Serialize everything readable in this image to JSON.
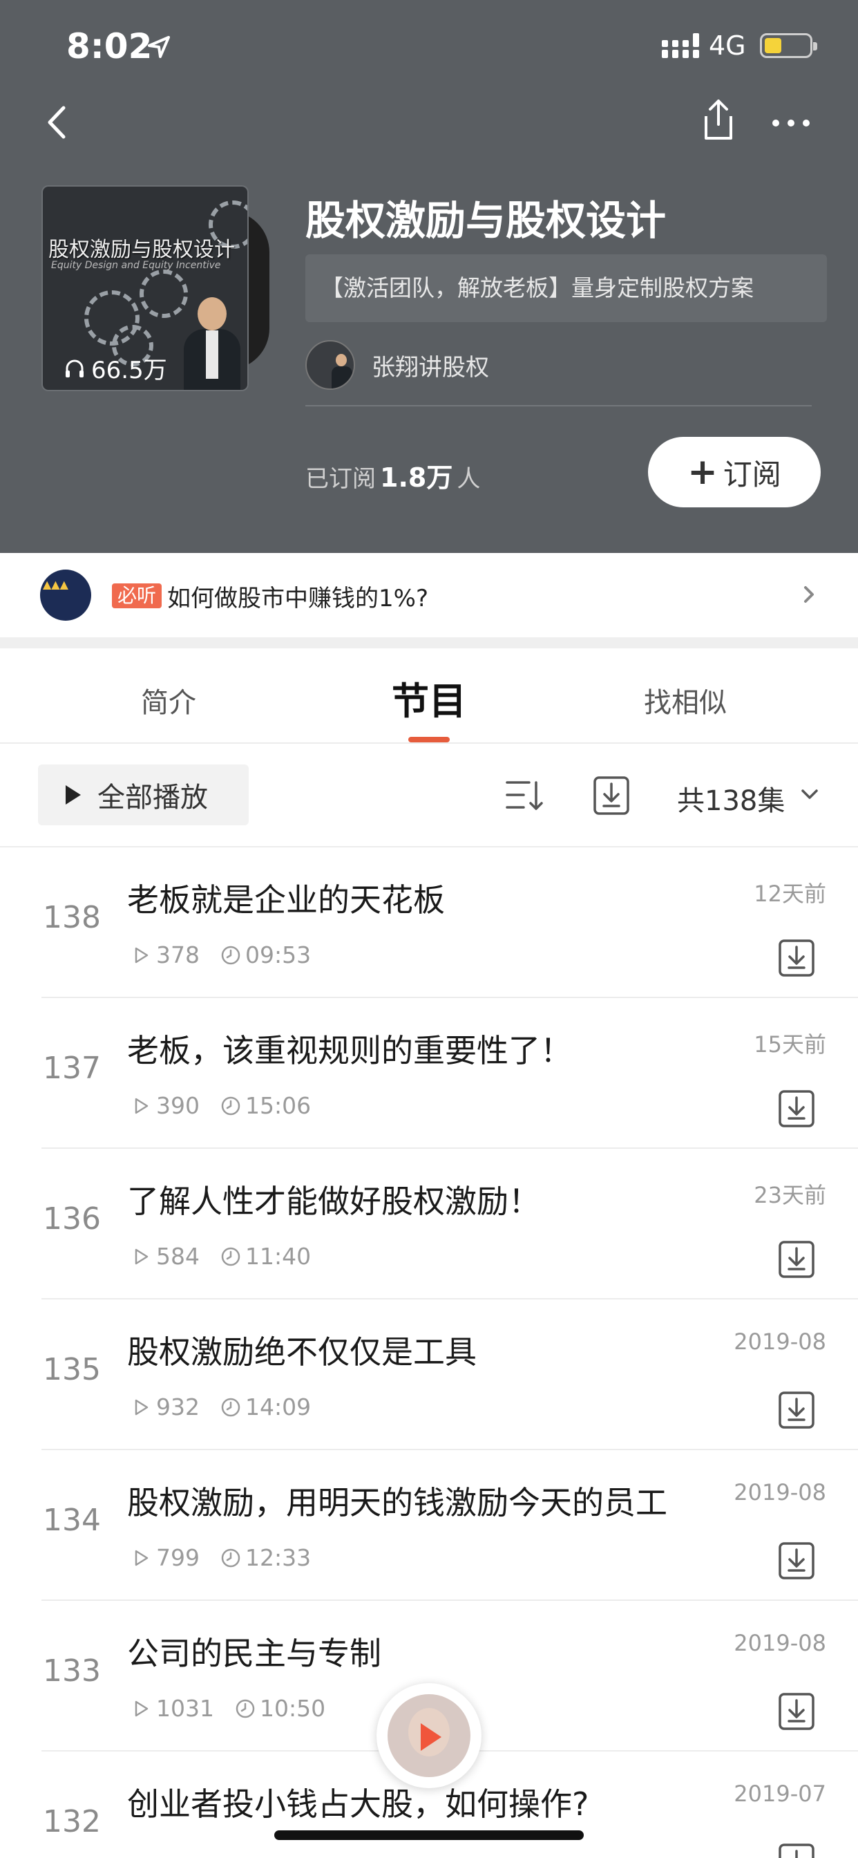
{
  "status_bar": {
    "time": "8:02",
    "network": "4G"
  },
  "album": {
    "title": "股权激励与股权设计",
    "tagline": "【激活团队，解放老板】量身定制股权方案",
    "author": "张翔讲股权",
    "plays": "66.5万",
    "cover_title": "股权激励与股权设计",
    "cover_subtitle": "Equity Design and Equity Incentive",
    "subscribers_prefix": "已订阅",
    "subscribers_count": "1.8万",
    "subscribers_suffix": "人",
    "subscribe_label": "订阅"
  },
  "promo": {
    "badge": "必听",
    "text": "如何做股市中赚钱的1%?"
  },
  "tabs": [
    {
      "label": "简介",
      "active": false
    },
    {
      "label": "节目",
      "active": true
    },
    {
      "label": "找相似",
      "active": false
    }
  ],
  "toolbar": {
    "play_all": "全部播放",
    "episode_count": "共138集"
  },
  "episodes": [
    {
      "num": "138",
      "title": "老板就是企业的天花板",
      "date": "12天前",
      "plays": "378",
      "duration": "09:53"
    },
    {
      "num": "137",
      "title": "老板，该重视规则的重要性了！",
      "date": "15天前",
      "plays": "390",
      "duration": "15:06"
    },
    {
      "num": "136",
      "title": "了解人性才能做好股权激励！",
      "date": "23天前",
      "plays": "584",
      "duration": "11:40"
    },
    {
      "num": "135",
      "title": "股权激励绝不仅仅是工具",
      "date": "2019-08",
      "plays": "932",
      "duration": "14:09"
    },
    {
      "num": "134",
      "title": "股权激励，用明天的钱激励今天的员工",
      "date": "2019-08",
      "plays": "799",
      "duration": "12:33"
    },
    {
      "num": "133",
      "title": "公司的民主与专制",
      "date": "2019-08",
      "plays": "1031",
      "duration": "10:50"
    },
    {
      "num": "132",
      "title": "创业者投小钱占大股，如何操作?",
      "date": "2019-07",
      "plays": "",
      "duration": ""
    }
  ],
  "colors": {
    "header_bg": "#5a5e62",
    "accent": "#e65c3c",
    "badge": "#f06a4e"
  }
}
